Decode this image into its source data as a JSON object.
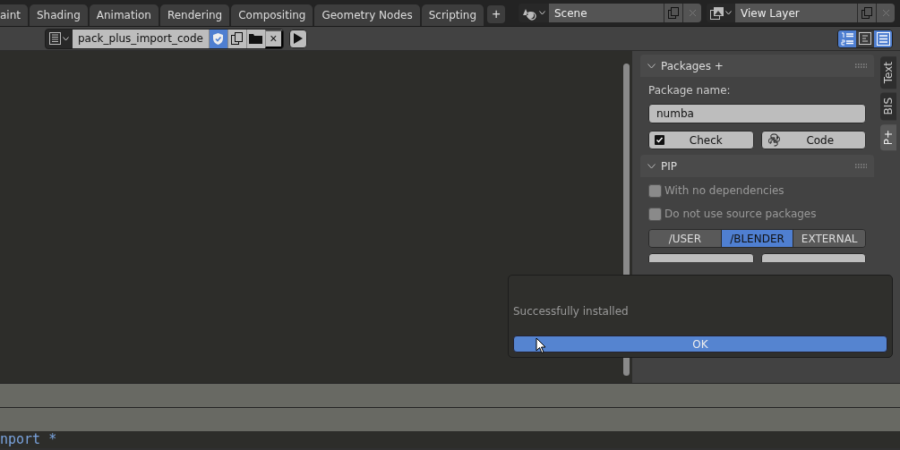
{
  "workspace_tabs": [
    {
      "label": "aint",
      "selected": false
    },
    {
      "label": "Shading",
      "selected": false
    },
    {
      "label": "Animation",
      "selected": false
    },
    {
      "label": "Rendering",
      "selected": false
    },
    {
      "label": "Compositing",
      "selected": false
    },
    {
      "label": "Geometry Nodes",
      "selected": false
    },
    {
      "label": "Scripting",
      "selected": false
    }
  ],
  "add_tab": "+",
  "scene": {
    "name": "Scene"
  },
  "view_layer": {
    "name": "View Layer"
  },
  "text_editor": {
    "file_name": "pack_plus_import_code",
    "trusted": true,
    "close": "×",
    "code_lines": [
      "nport *"
    ]
  },
  "view_toggles": [
    {
      "on": true
    },
    {
      "on": false
    },
    {
      "on": true
    }
  ],
  "sidebar": {
    "tabs": [
      {
        "label": "Text",
        "selected": false
      },
      {
        "label": "BIS",
        "selected": false
      },
      {
        "label": "P+",
        "selected": true
      }
    ],
    "packages_panel": {
      "title": "Packages +",
      "expanded": true,
      "field_label": "Package name:",
      "field_value": "numba",
      "buttons": [
        {
          "label": "Check",
          "kind": "checkbox"
        },
        {
          "label": "Code",
          "kind": "python"
        }
      ]
    },
    "pip_panel": {
      "title": "PIP",
      "expanded": true,
      "options": [
        {
          "label": "With no dependencies",
          "checked": false
        },
        {
          "label": "Do not use source packages",
          "checked": false
        }
      ],
      "targets": [
        {
          "label": "/USER",
          "selected": false
        },
        {
          "label": "/BLENDER",
          "selected": true
        },
        {
          "label": "EXTERNAL",
          "selected": false
        }
      ]
    }
  },
  "dialog": {
    "message": "Successfully installed",
    "ok_button": "OK"
  }
}
